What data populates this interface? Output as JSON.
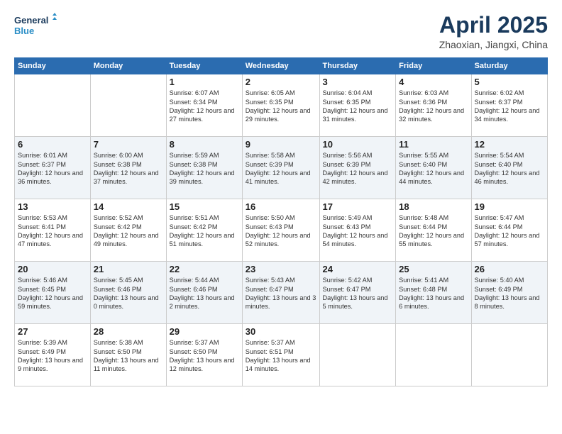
{
  "header": {
    "logo_general": "General",
    "logo_blue": "Blue",
    "month": "April 2025",
    "location": "Zhaoxian, Jiangxi, China"
  },
  "weekdays": [
    "Sunday",
    "Monday",
    "Tuesday",
    "Wednesday",
    "Thursday",
    "Friday",
    "Saturday"
  ],
  "weeks": [
    [
      {
        "day": "",
        "sunrise": "",
        "sunset": "",
        "daylight": ""
      },
      {
        "day": "",
        "sunrise": "",
        "sunset": "",
        "daylight": ""
      },
      {
        "day": "1",
        "sunrise": "Sunrise: 6:07 AM",
        "sunset": "Sunset: 6:34 PM",
        "daylight": "Daylight: 12 hours and 27 minutes."
      },
      {
        "day": "2",
        "sunrise": "Sunrise: 6:05 AM",
        "sunset": "Sunset: 6:35 PM",
        "daylight": "Daylight: 12 hours and 29 minutes."
      },
      {
        "day": "3",
        "sunrise": "Sunrise: 6:04 AM",
        "sunset": "Sunset: 6:35 PM",
        "daylight": "Daylight: 12 hours and 31 minutes."
      },
      {
        "day": "4",
        "sunrise": "Sunrise: 6:03 AM",
        "sunset": "Sunset: 6:36 PM",
        "daylight": "Daylight: 12 hours and 32 minutes."
      },
      {
        "day": "5",
        "sunrise": "Sunrise: 6:02 AM",
        "sunset": "Sunset: 6:37 PM",
        "daylight": "Daylight: 12 hours and 34 minutes."
      }
    ],
    [
      {
        "day": "6",
        "sunrise": "Sunrise: 6:01 AM",
        "sunset": "Sunset: 6:37 PM",
        "daylight": "Daylight: 12 hours and 36 minutes."
      },
      {
        "day": "7",
        "sunrise": "Sunrise: 6:00 AM",
        "sunset": "Sunset: 6:38 PM",
        "daylight": "Daylight: 12 hours and 37 minutes."
      },
      {
        "day": "8",
        "sunrise": "Sunrise: 5:59 AM",
        "sunset": "Sunset: 6:38 PM",
        "daylight": "Daylight: 12 hours and 39 minutes."
      },
      {
        "day": "9",
        "sunrise": "Sunrise: 5:58 AM",
        "sunset": "Sunset: 6:39 PM",
        "daylight": "Daylight: 12 hours and 41 minutes."
      },
      {
        "day": "10",
        "sunrise": "Sunrise: 5:56 AM",
        "sunset": "Sunset: 6:39 PM",
        "daylight": "Daylight: 12 hours and 42 minutes."
      },
      {
        "day": "11",
        "sunrise": "Sunrise: 5:55 AM",
        "sunset": "Sunset: 6:40 PM",
        "daylight": "Daylight: 12 hours and 44 minutes."
      },
      {
        "day": "12",
        "sunrise": "Sunrise: 5:54 AM",
        "sunset": "Sunset: 6:40 PM",
        "daylight": "Daylight: 12 hours and 46 minutes."
      }
    ],
    [
      {
        "day": "13",
        "sunrise": "Sunrise: 5:53 AM",
        "sunset": "Sunset: 6:41 PM",
        "daylight": "Daylight: 12 hours and 47 minutes."
      },
      {
        "day": "14",
        "sunrise": "Sunrise: 5:52 AM",
        "sunset": "Sunset: 6:42 PM",
        "daylight": "Daylight: 12 hours and 49 minutes."
      },
      {
        "day": "15",
        "sunrise": "Sunrise: 5:51 AM",
        "sunset": "Sunset: 6:42 PM",
        "daylight": "Daylight: 12 hours and 51 minutes."
      },
      {
        "day": "16",
        "sunrise": "Sunrise: 5:50 AM",
        "sunset": "Sunset: 6:43 PM",
        "daylight": "Daylight: 12 hours and 52 minutes."
      },
      {
        "day": "17",
        "sunrise": "Sunrise: 5:49 AM",
        "sunset": "Sunset: 6:43 PM",
        "daylight": "Daylight: 12 hours and 54 minutes."
      },
      {
        "day": "18",
        "sunrise": "Sunrise: 5:48 AM",
        "sunset": "Sunset: 6:44 PM",
        "daylight": "Daylight: 12 hours and 55 minutes."
      },
      {
        "day": "19",
        "sunrise": "Sunrise: 5:47 AM",
        "sunset": "Sunset: 6:44 PM",
        "daylight": "Daylight: 12 hours and 57 minutes."
      }
    ],
    [
      {
        "day": "20",
        "sunrise": "Sunrise: 5:46 AM",
        "sunset": "Sunset: 6:45 PM",
        "daylight": "Daylight: 12 hours and 59 minutes."
      },
      {
        "day": "21",
        "sunrise": "Sunrise: 5:45 AM",
        "sunset": "Sunset: 6:46 PM",
        "daylight": "Daylight: 13 hours and 0 minutes."
      },
      {
        "day": "22",
        "sunrise": "Sunrise: 5:44 AM",
        "sunset": "Sunset: 6:46 PM",
        "daylight": "Daylight: 13 hours and 2 minutes."
      },
      {
        "day": "23",
        "sunrise": "Sunrise: 5:43 AM",
        "sunset": "Sunset: 6:47 PM",
        "daylight": "Daylight: 13 hours and 3 minutes."
      },
      {
        "day": "24",
        "sunrise": "Sunrise: 5:42 AM",
        "sunset": "Sunset: 6:47 PM",
        "daylight": "Daylight: 13 hours and 5 minutes."
      },
      {
        "day": "25",
        "sunrise": "Sunrise: 5:41 AM",
        "sunset": "Sunset: 6:48 PM",
        "daylight": "Daylight: 13 hours and 6 minutes."
      },
      {
        "day": "26",
        "sunrise": "Sunrise: 5:40 AM",
        "sunset": "Sunset: 6:49 PM",
        "daylight": "Daylight: 13 hours and 8 minutes."
      }
    ],
    [
      {
        "day": "27",
        "sunrise": "Sunrise: 5:39 AM",
        "sunset": "Sunset: 6:49 PM",
        "daylight": "Daylight: 13 hours and 9 minutes."
      },
      {
        "day": "28",
        "sunrise": "Sunrise: 5:38 AM",
        "sunset": "Sunset: 6:50 PM",
        "daylight": "Daylight: 13 hours and 11 minutes."
      },
      {
        "day": "29",
        "sunrise": "Sunrise: 5:37 AM",
        "sunset": "Sunset: 6:50 PM",
        "daylight": "Daylight: 13 hours and 12 minutes."
      },
      {
        "day": "30",
        "sunrise": "Sunrise: 5:37 AM",
        "sunset": "Sunset: 6:51 PM",
        "daylight": "Daylight: 13 hours and 14 minutes."
      },
      {
        "day": "",
        "sunrise": "",
        "sunset": "",
        "daylight": ""
      },
      {
        "day": "",
        "sunrise": "",
        "sunset": "",
        "daylight": ""
      },
      {
        "day": "",
        "sunrise": "",
        "sunset": "",
        "daylight": ""
      }
    ]
  ]
}
